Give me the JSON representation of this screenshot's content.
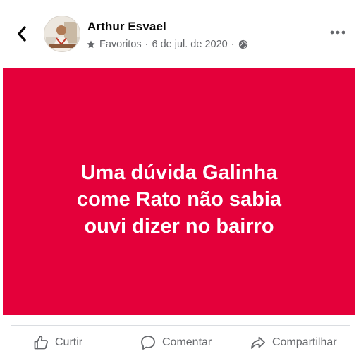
{
  "header": {
    "back_icon": "chevron-left-icon",
    "author_name": "Arthur Esvael",
    "audience_icon": "star-icon",
    "audience_label": "Favoritos",
    "separator": "·",
    "date": "6 de jul. de 2020",
    "privacy_icon": "globe-icon",
    "more_icon": "more-horizontal-icon"
  },
  "post": {
    "background_color": "#e4003a",
    "text": "Uma dúvida Galinha\ncome Rato não sabia\nouvi dizer no bairro"
  },
  "actions": {
    "like_label": "Curtir",
    "comment_label": "Comentar",
    "share_label": "Compartilhar"
  }
}
